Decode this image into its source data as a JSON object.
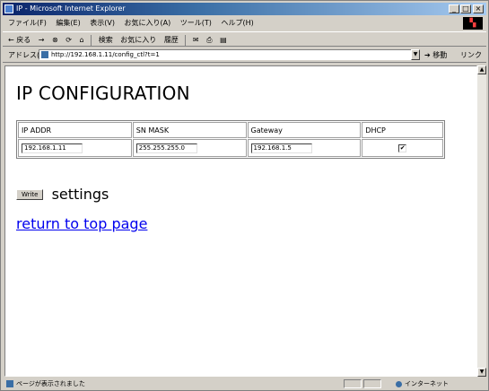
{
  "window": {
    "title": "IP - Microsoft Internet Explorer",
    "min_glyph": "_",
    "max_glyph": "□",
    "close_glyph": "×"
  },
  "menubar": {
    "items": [
      {
        "label": "ファイル(F)"
      },
      {
        "label": "編集(E)"
      },
      {
        "label": "表示(V)"
      },
      {
        "label": "お気に入り(A)"
      },
      {
        "label": "ツール(T)"
      },
      {
        "label": "ヘルプ(H)"
      }
    ]
  },
  "toolbar": {
    "back_label": "← 戻る",
    "forward_label": "→",
    "stop_glyph": "⊗",
    "refresh_glyph": "⟳",
    "home_glyph": "⌂",
    "search_label": "検索",
    "favorites_label": "お気に入り",
    "history_label": "履歴"
  },
  "address": {
    "label": "アドレス(D)",
    "url": "http://192.168.1.11/config_ctl?t=1",
    "go_label": "移動",
    "links_label": "リンク »"
  },
  "page": {
    "heading": "IP CONFIGURATION",
    "table": {
      "headers": [
        "IP ADDR",
        "SN MASK",
        "Gateway",
        "DHCP"
      ],
      "values": {
        "ip_addr": "192.168.1.11",
        "sn_mask": "255.255.255.0",
        "gateway": "192.168.1.5",
        "dhcp_checked": true,
        "check_glyph": "✔"
      }
    },
    "write_button": "Write",
    "settings_text": "settings",
    "return_link": "return to top page"
  },
  "statusbar": {
    "text": "ページが表示されました",
    "zone": "インターネット"
  }
}
